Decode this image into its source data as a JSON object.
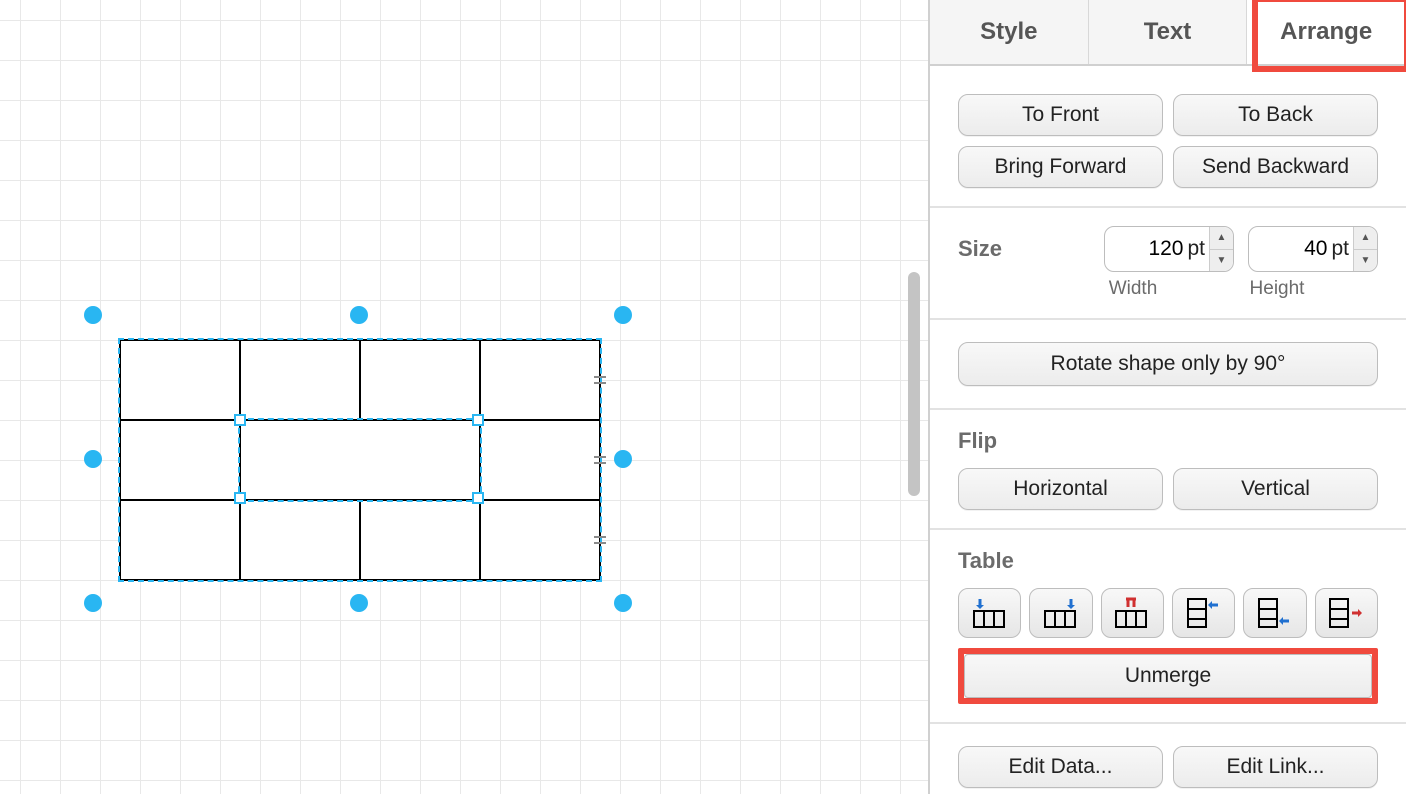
{
  "tabs": {
    "style": "Style",
    "text": "Text",
    "arrange": "Arrange"
  },
  "ordering": {
    "to_front": "To Front",
    "to_back": "To Back",
    "bring_forward": "Bring Forward",
    "send_backward": "Send Backward"
  },
  "size": {
    "label": "Size",
    "width_value": "120",
    "height_value": "40",
    "unit": "pt",
    "width_label": "Width",
    "height_label": "Height"
  },
  "rotate": {
    "button": "Rotate shape only by 90°"
  },
  "flip": {
    "label": "Flip",
    "horizontal": "Horizontal",
    "vertical": "Vertical"
  },
  "table": {
    "label": "Table",
    "unmerge": "Unmerge"
  },
  "edit": {
    "data": "Edit Data...",
    "link": "Edit Link..."
  },
  "canvas_shape": {
    "rows": 3,
    "cols": 4,
    "merged_center": true
  }
}
